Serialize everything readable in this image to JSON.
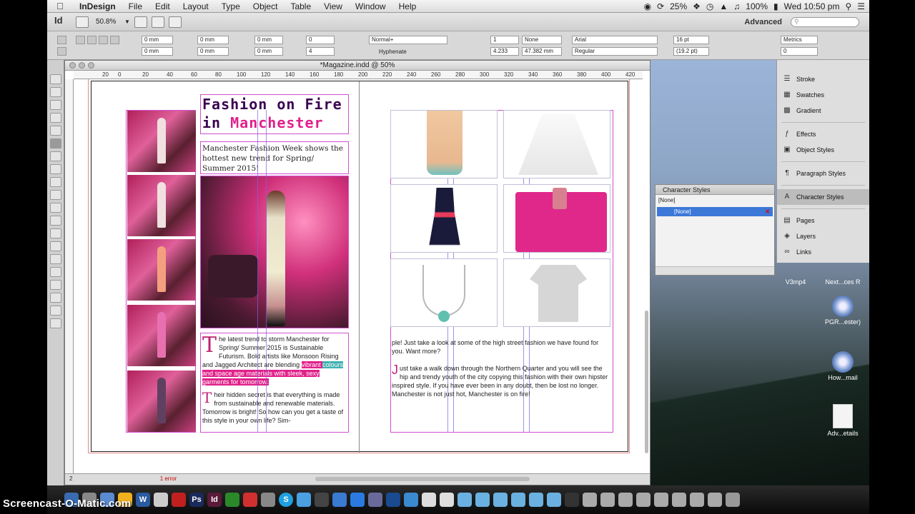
{
  "menubar": {
    "app": "InDesign",
    "items": [
      "File",
      "Edit",
      "Layout",
      "Type",
      "Object",
      "Table",
      "View",
      "Window",
      "Help"
    ],
    "battery_pct": "25%",
    "power": "100%",
    "clock": "Wed 10:50 pm"
  },
  "appbar": {
    "logo": "Id",
    "zoom": "50.8%",
    "workspace": "Advanced"
  },
  "control": {
    "indent1": "0 mm",
    "indent2": "0 mm",
    "indent3": "0 mm",
    "indent4": "0 mm",
    "space1": "0 mm",
    "space2": "0 mm",
    "dropcap_lines": "0",
    "dropcap_chars": "4",
    "style": "Normal+",
    "hyphenate": "Hyphenate",
    "cols": "1",
    "col_val": "4.233",
    "width": "47.382 mm",
    "none": "None",
    "font": "Arial",
    "font_style": "Regular",
    "size": "16 pt",
    "leading": "(19.2 pt)",
    "kerning": "Metrics",
    "tracking": "0"
  },
  "document": {
    "title": "*Magazine.indd @ 50%",
    "ruler": [
      "20",
      "0",
      "20",
      "40",
      "60",
      "80",
      "100",
      "120",
      "140",
      "160",
      "180",
      "200",
      "220",
      "240",
      "260",
      "280",
      "300",
      "320",
      "340",
      "360",
      "380",
      "400",
      "420"
    ],
    "status_page": "2",
    "status_error": "1 error"
  },
  "left_page": {
    "title_line1": "Fashion on Fire",
    "title_line2_prefix": "in ",
    "title_line2_city": "Manchester",
    "subtitle": "Manchester Fashion Week shows the hottest new trend for Spring/ Summer 2015!",
    "body_dropcap": "T",
    "body_p1_a": "he latest trend to storm Manchester for Spring/ Summer 2015 is Sustainable Futurism. Bold artists like Monsoon Rising and Jagged Architect are blending ",
    "body_p1_hl1": "vibrant ",
    "body_p1_hl2": "colours",
    "body_p1_hl3": " and space age materials with sleek, sexy garments for tomorrow.",
    "body_dropcap2": "T",
    "body_p2": "heir hidden secret is that everything is made from sustainable and renewable materials. Tomorrow is bright! So how can you get a taste of this style in your own life? Sim-"
  },
  "right_page": {
    "p1": "ple! Just take a look at some of the high street fashion we have found for you. Want more?",
    "dropcap": "J",
    "p2": "ust take a walk down through the Northern Quarter and you will see the hip and trendy youth of the city copying this fashion with their own hipster inspired style. If you have ever been in any doubt, then be lost no longer. Manchester is not just hot, Manchester is on fire!"
  },
  "dock_panel": {
    "items": [
      "Stroke",
      "Swatches",
      "Gradient",
      "Effects",
      "Object Styles",
      "Paragraph Styles",
      "Character Styles",
      "Pages",
      "Layers",
      "Links"
    ]
  },
  "char_styles": {
    "title": "Character Styles",
    "current": "[None]",
    "row": "[None]"
  },
  "desktop": {
    "icon1": "V3mp4",
    "icon2": "Next...ces R",
    "icon3": "PGR...ester)",
    "icon4": "How...mail",
    "icon5": "Adv...etails"
  },
  "watermark": "Screencast-O-Matic.com"
}
